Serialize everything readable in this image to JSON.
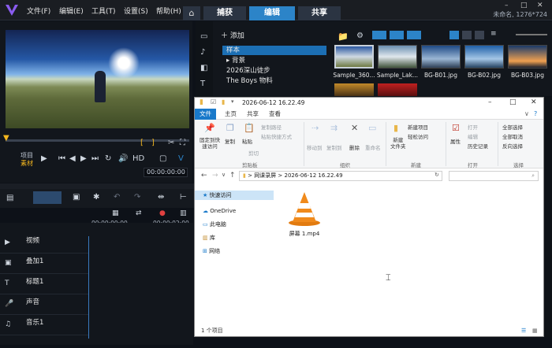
{
  "app": {
    "menu": [
      "文件(F)",
      "编辑(E)",
      "工具(T)",
      "设置(S)",
      "帮助(H)"
    ],
    "tabs": [
      "捕获",
      "编辑",
      "共享"
    ],
    "active_tab": "编辑",
    "window_title": "未命名, 1276*724"
  },
  "preview": {
    "mode_project": "项目",
    "mode_clip": "素材",
    "timecode": "00:00:00:00"
  },
  "library": {
    "add_label": "添加",
    "folders": [
      "样本",
      "背景",
      "2026深山徒步",
      "The Boys 物料"
    ],
    "selected_folder": "样本",
    "thumbs": [
      "Sample_360...",
      "Sample_Lak...",
      "BG-B01.jpg",
      "BG-B02.jpg",
      "BG-B03.jpg"
    ]
  },
  "timeline": {
    "ruler_start": "00:00:00:00",
    "ruler_next": "00:00:02:00",
    "tracks": [
      "视频",
      "叠加1",
      "标题1",
      "声音",
      "音乐1"
    ]
  },
  "explorer": {
    "title": "2026-06-12 16.22.49",
    "tabs": [
      "文件",
      "主页",
      "共享",
      "查看"
    ],
    "ribbon": {
      "pin": "固定到快\n速访问",
      "copy": "复制",
      "paste": "粘贴",
      "copy_path": "复制路径",
      "paste_shortcut": "粘贴快捷方式",
      "cut": "剪切",
      "clipboard_group": "剪贴板",
      "move_to": "移动到",
      "copy_to": "复制到",
      "delete": "删除",
      "rename": "重命名",
      "organize_group": "组织",
      "new_folder": "新建\n文件夹",
      "new_item": "新建项目",
      "easy_access": "轻松访问",
      "new_group": "新建",
      "properties": "属性",
      "open": "打开",
      "edit": "编辑",
      "history": "历史记录",
      "open_group": "打开",
      "select_all": "全部选择",
      "select_none": "全部取消",
      "invert": "反向选择",
      "select_group": "选择"
    },
    "address": [
      "网课录屏",
      "2026-06-12 16.22.49"
    ],
    "nav_items": [
      "快速访问",
      "OneDrive",
      "此电脑",
      "库",
      "网络"
    ],
    "selected_nav": "快速访问",
    "file_name": "屏幕 1.mp4",
    "status": "1 个项目"
  },
  "colors": {
    "accent_blue": "#2c84c8",
    "vlc_orange": "#f08a1c"
  }
}
